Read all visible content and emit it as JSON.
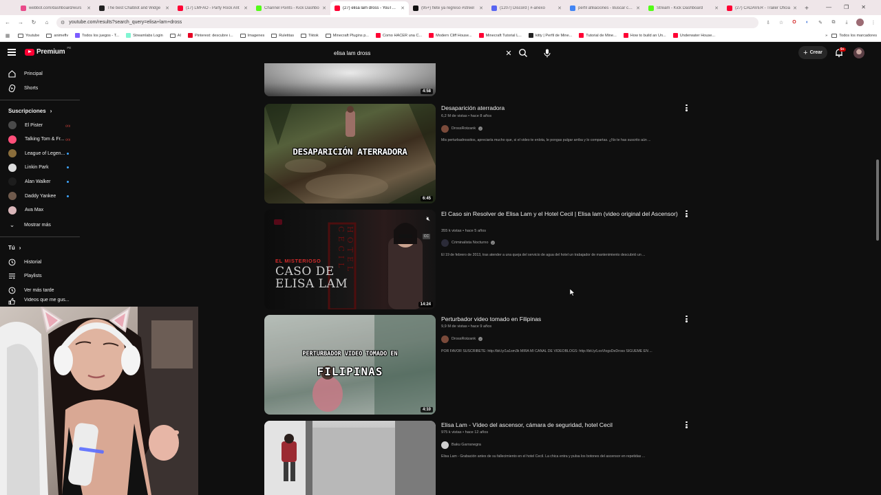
{
  "browser": {
    "tabs": [
      {
        "title": "webbot.com/dashboard/wu/s",
        "color": "#e94a8a",
        "active": false
      },
      {
        "title": "The best ChatBot and Widge",
        "color": "#222222",
        "active": false
      },
      {
        "title": "(17) LMFAO - Party Rock Ant",
        "color": "#ff0033",
        "active": false
      },
      {
        "title": "Channel Points - Kick Dashbo",
        "color": "#53fc18",
        "active": false
      },
      {
        "title": "(27) elisa lam dross - YouTube",
        "color": "#ff0033",
        "active": true
      },
      {
        "title": "(95+) flete ya regreso #streel",
        "color": "#111111",
        "active": false
      },
      {
        "title": "(1207) Discord | #-anexo",
        "color": "#5865f2",
        "active": false
      },
      {
        "title": "perfil afiliaciones - Buscar con G",
        "color": "#4285f4",
        "active": false
      },
      {
        "title": "Stream - Kick Dashboard",
        "color": "#53fc18",
        "active": false
      },
      {
        "title": "(27) CADAVER - Trailer Oficia",
        "color": "#ff0033",
        "active": false
      }
    ],
    "url": "youtube.com/results?search_query=elisa+lam+dross",
    "bookmarks": [
      {
        "label": "Youtube",
        "kind": "folder"
      },
      {
        "label": "animeflv",
        "kind": "folder"
      },
      {
        "label": "Todos los juegos - T...",
        "color": "#7b5cff"
      },
      {
        "label": "Streamlabs Login",
        "color": "#80f5d2"
      },
      {
        "label": "AI",
        "kind": "folder"
      },
      {
        "label": "Pinterest: descubre i...",
        "color": "#e60023"
      },
      {
        "label": "Imagenes",
        "kind": "folder"
      },
      {
        "label": "Ruletitas",
        "kind": "folder"
      },
      {
        "label": "Tiktok",
        "kind": "folder"
      },
      {
        "label": "Minecraft Plugins p...",
        "kind": "folder"
      },
      {
        "label": "Como HACER una C...",
        "color": "#ff0033"
      },
      {
        "label": "Modern Cliff House...",
        "color": "#ff0033"
      },
      {
        "label": "Minecraft Tutorial L...",
        "color": "#ff0033"
      },
      {
        "label": "kitty | Perfil de Mine...",
        "color": "#222222"
      },
      {
        "label": "Tutorial de Mine...",
        "color": "#ff0033"
      },
      {
        "label": "How to build an Un...",
        "color": "#ff0033"
      },
      {
        "label": "Underwater House...",
        "color": "#ff0033"
      }
    ],
    "bookmarks_all": "Todos los marcadores"
  },
  "header": {
    "logo_text": "Premium",
    "region": "PE",
    "search_query": "elisa lam dross",
    "create_label": "Crear",
    "notif_count": "9+"
  },
  "sidebar": {
    "top": [
      {
        "label": "Principal",
        "icon": "home-icon"
      },
      {
        "label": "Shorts",
        "icon": "shorts-icon"
      }
    ],
    "subs_heading": "Suscripciones",
    "subs": [
      {
        "label": "El Pister",
        "color": "#4a4a4a",
        "marker": "live"
      },
      {
        "label": "Talking Tom & Fr...",
        "color": "#ff4f7a",
        "marker": "live"
      },
      {
        "label": "League of Legen...",
        "color": "#8a6d3b",
        "marker": "dot"
      },
      {
        "label": "Linkin Park",
        "color": "#dddddd",
        "marker": "dot"
      },
      {
        "label": "Alan Walker",
        "color": "#1d1d1d",
        "marker": "dot"
      },
      {
        "label": "Daddy Yankee",
        "color": "#6f5a4c",
        "marker": "dot"
      },
      {
        "label": "Ava Max",
        "color": "#d9b6b9",
        "marker": "none"
      }
    ],
    "show_more": "Mostrar más",
    "you_heading": "Tú",
    "you_items": [
      {
        "label": "Historial",
        "icon": "history-icon"
      },
      {
        "label": "Playlists",
        "icon": "playlist-icon"
      },
      {
        "label": "Ver más tarde",
        "icon": "clock-icon"
      },
      {
        "label": "Videos que me gus...",
        "icon": "like-icon"
      }
    ]
  },
  "results": [
    {
      "title": "",
      "duration": "4:58",
      "partial_top": true
    },
    {
      "title": "Desaparición aterradora",
      "meta": "6,2 M de vistas • hace 8 años",
      "channel": "DrossRotzank",
      "verified": true,
      "description": "Mis perturbadrossitos, apreciaría mucho que, si el video te enlota, le pongas pulgar arriba y lo compartas. ¿No te has suscrito aún ...",
      "duration": "6:45",
      "thumb_text": "DESAPARICIÓN ATERRADORA"
    },
    {
      "title": "El Caso sin Resolver de Elisa Lam y el Hotel Cecil | Elisa lam (video original del Ascensor)",
      "meta": "355 k vistas • hace 5 años",
      "channel": "Criminalista Nocturno",
      "verified": true,
      "description": "El 19 de febrero de 2013, tras atender a una queja del servicio de agua del hotel un trabajador de mantenimiento descubrió un ...",
      "duration": "14:24",
      "thumb_text_1": "EL MISTERIOSO",
      "thumb_text_2": "CASO DE",
      "thumb_text_3": "ELISA LAM",
      "thumb_side": "HOTEL CECIL",
      "cc": "CC"
    },
    {
      "title": "Perturbador video tomado en Filipinas",
      "meta": "9,9 M de vistas • hace 9 años",
      "channel": "DrossRotzank",
      "verified": true,
      "description": "POR FAVOR SUSCRÍBETE: http://bit.ly/1a1sm3k MIRA MI CANAL DE VIDEOBLOGS: http://bit.ly/LosVlogsDeDross SÍGUEME EN ...",
      "duration": "4:10",
      "thumb_text_1": "PERTURBADOR VIDEO TOMADO EN",
      "thumb_text_2": "FILIPINAS"
    },
    {
      "title": "Elisa Lam - Vídeo del ascensor, cámara de seguridad, hotel Cecil",
      "meta": "975 k vistas • hace 12 años",
      "channel": "Baku Garranegra",
      "verified": false,
      "description": "Elisa Lam - Grabación antes de su fallecimiento en el hotel Cecil. La chica entra y pulsa los botones del ascensor en repetidas ..."
    }
  ],
  "colors": {
    "bg": "#0f0f0f",
    "brand": "#ff0033",
    "text": "#f1f1f1",
    "secondary": "#aaaaaa"
  }
}
